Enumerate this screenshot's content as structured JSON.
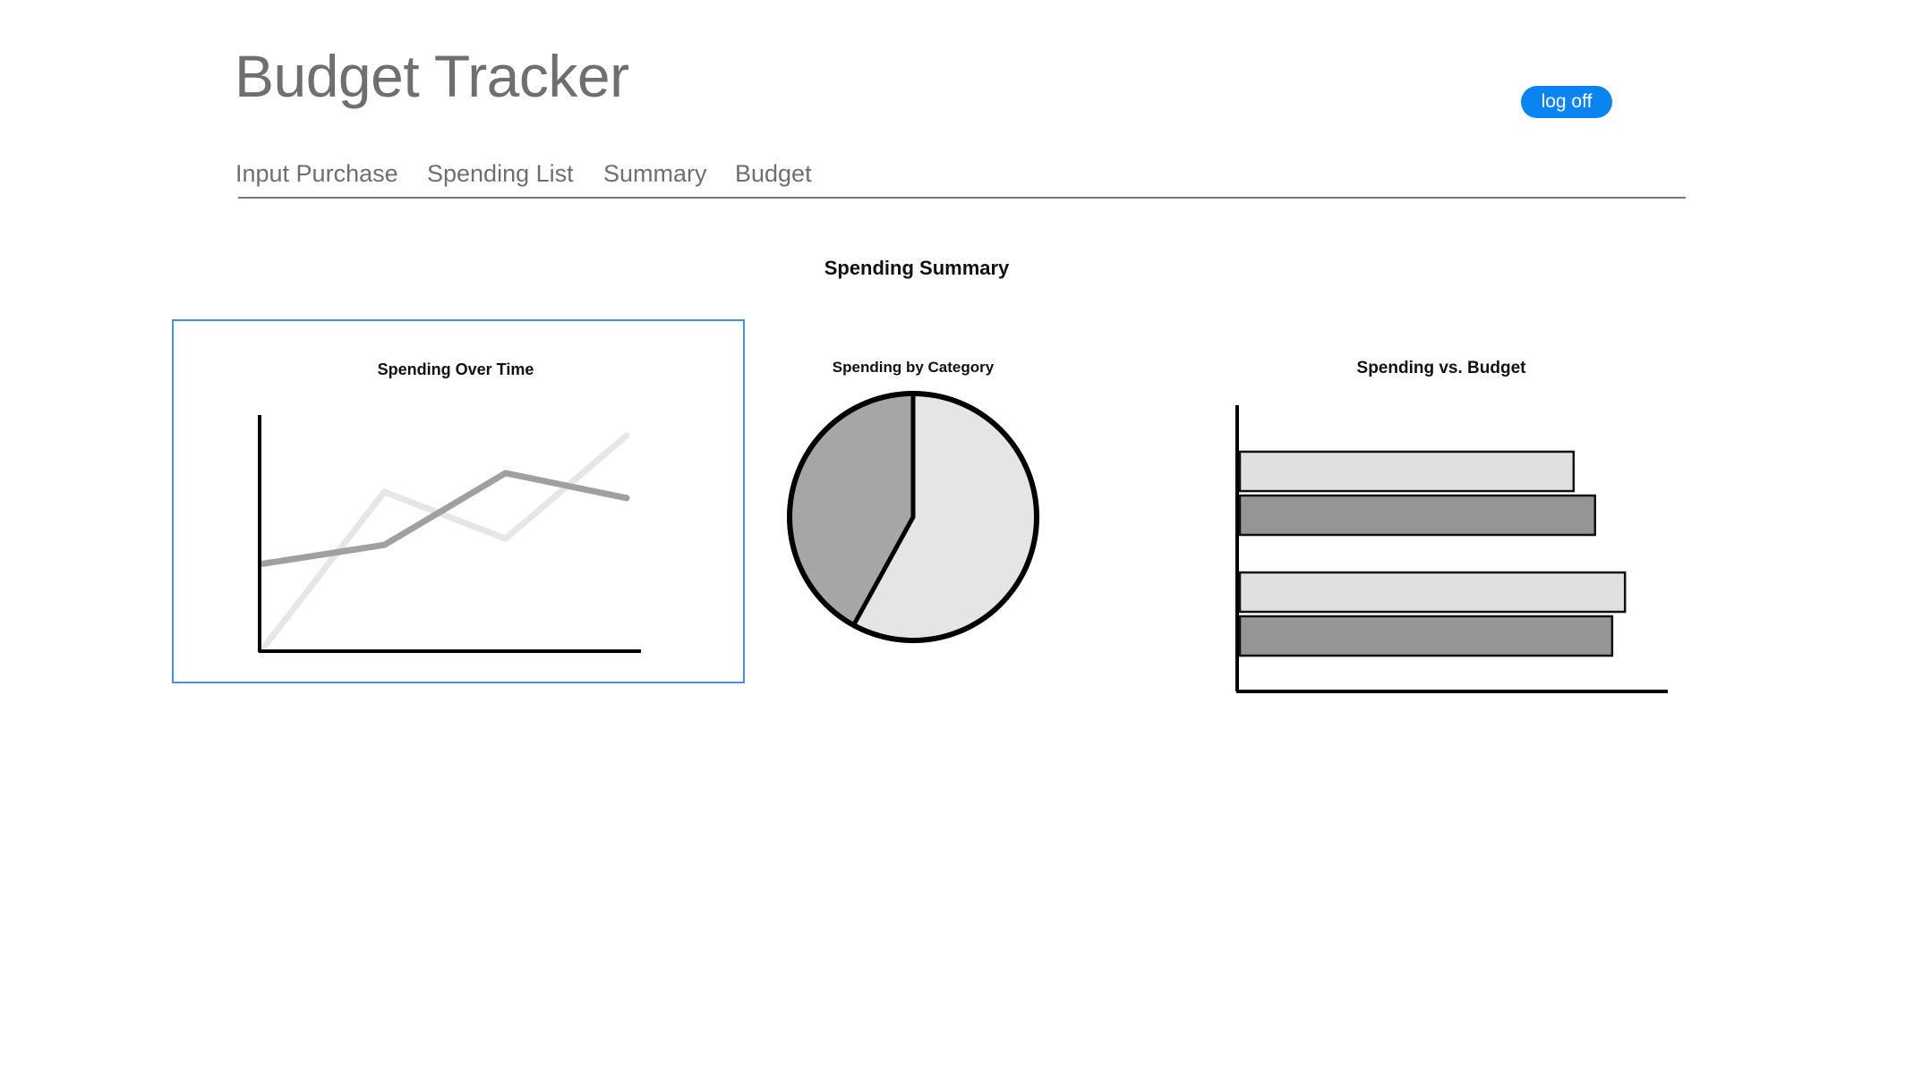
{
  "app": {
    "title": "Budget Tracker",
    "logoff_label": "log off"
  },
  "nav": {
    "items": [
      {
        "label": "Input Purchase"
      },
      {
        "label": "Spending List"
      },
      {
        "label": "Summary"
      },
      {
        "label": "Budget"
      }
    ]
  },
  "main": {
    "title": "Spending Summary"
  },
  "colors": {
    "accent": "#0a84f0",
    "selected_border": "#4a90d9",
    "series_dark": "#a0a0a0",
    "series_light": "#e6e6e6",
    "pie_dark": "#a6a6a6",
    "pie_light": "#e5e5e5",
    "bar_light": "#e0e0e0",
    "bar_dark": "#959595"
  },
  "chart_data": [
    {
      "type": "line",
      "title": "Spending Over Time",
      "selected": true,
      "x": [
        0,
        1,
        2,
        3
      ],
      "series": [
        {
          "values": [
            5.6,
            6.8,
            11.4,
            9.8
          ]
        },
        {
          "values": [
            0.2,
            10.2,
            7.2,
            13.8
          ]
        }
      ],
      "ylim": [
        0,
        15
      ]
    },
    {
      "type": "pie",
      "title": "Spending by Category",
      "values": [
        58,
        42
      ]
    },
    {
      "type": "bar",
      "orientation": "horizontal",
      "title": "Spending vs. Budget",
      "series": [
        {
          "values": [
            78,
            90
          ]
        },
        {
          "values": [
            83,
            87
          ]
        }
      ],
      "xlim": [
        0,
        100
      ]
    }
  ]
}
